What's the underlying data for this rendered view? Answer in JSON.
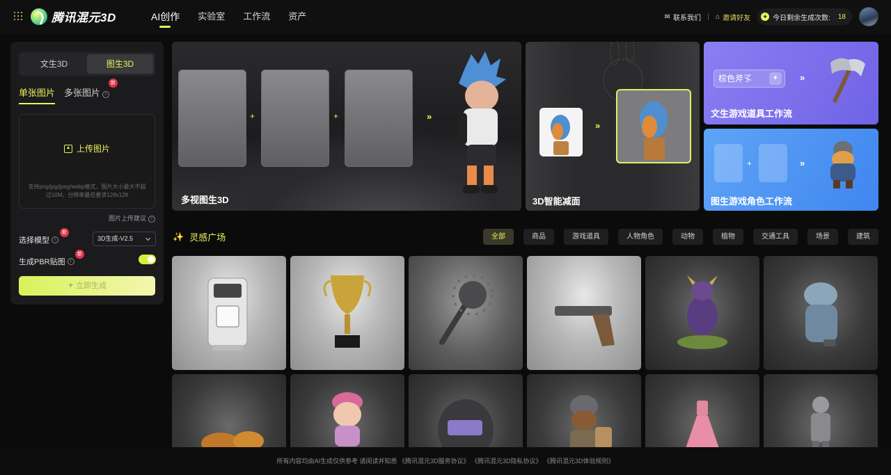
{
  "app": {
    "logo_text": "腾讯混元3D"
  },
  "nav": [
    {
      "label": "AI创作",
      "active": true
    },
    {
      "label": "实验室"
    },
    {
      "label": "工作流"
    },
    {
      "label": "资产"
    }
  ],
  "header_right": {
    "contact": "联系我们",
    "invite": "邀请好友",
    "quota_label": "今日剩余生成次数:",
    "quota_count": "18"
  },
  "panel": {
    "modes": [
      "文生3D",
      "图生3D"
    ],
    "active_mode": "图生3D",
    "subtabs": [
      "单张图片",
      "多张图片"
    ],
    "new_badge": "新",
    "upload_label": "上传图片",
    "upload_hint": "支持png/jpg/jpeg/webp格式，图片大小最大不超过10M，分辨率最低要求128x128",
    "upload_advice": "图片上传建议",
    "model_label": "选择模型",
    "model_value": "3D生成-V2.5",
    "pbr_label": "生成PBR贴图",
    "pbr_enabled": true,
    "generate_label": "立即生成"
  },
  "banners": {
    "multi_view": "多视图生3D",
    "reduce": "3D智能减面",
    "text_game": "文生游戏道具工作流",
    "text_game_prompt": "棕色斧孓",
    "image_game": "图生游戏角色工作流"
  },
  "inspiration": {
    "title": "灵感广场",
    "filters": [
      "全部",
      "商品",
      "游戏道具",
      "人物角色",
      "动物",
      "植物",
      "交通工具",
      "场景",
      "建筑"
    ],
    "active_filter": "全部",
    "cards": [
      {
        "subject": "vending-kiosk"
      },
      {
        "subject": "trophy"
      },
      {
        "subject": "spiked-mace"
      },
      {
        "subject": "pistol"
      },
      {
        "subject": "demon-creature"
      },
      {
        "subject": "shark-warrior"
      },
      {
        "subject": "gold-dragon"
      },
      {
        "subject": "girl-doll"
      },
      {
        "subject": "welding-helmet"
      },
      {
        "subject": "bear-knight"
      },
      {
        "subject": "pink-dress"
      },
      {
        "subject": "armored-soldier"
      }
    ]
  },
  "footer": "所有内容均由AI生成仅供参考 请阅读并知悉 《腾讯混元3D服务协议》 《腾讯混元3D隐私协议》 《腾讯混元3D体验规则》"
}
